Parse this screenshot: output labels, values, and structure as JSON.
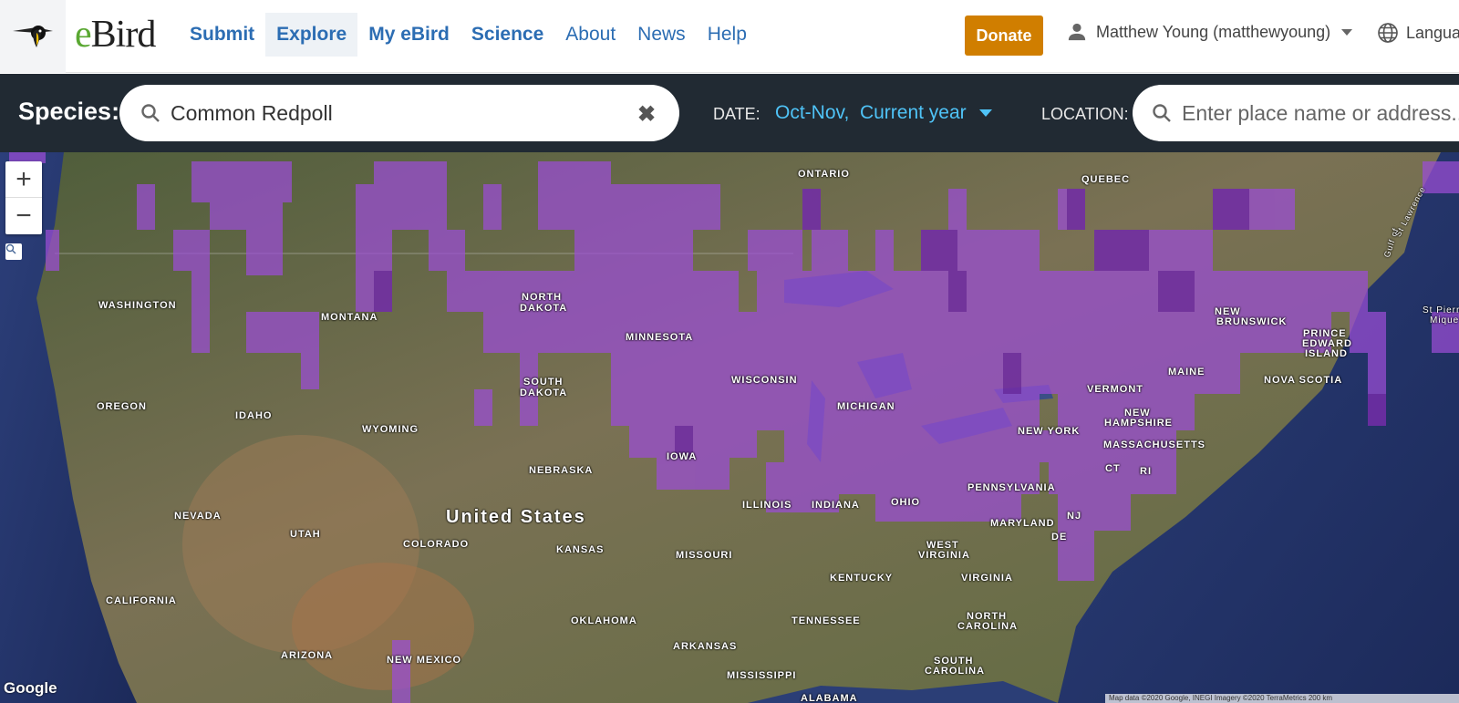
{
  "nav": {
    "logo_text_e": "e",
    "logo_text_rest": "Bird",
    "links": [
      {
        "label": "Submit",
        "bold": true
      },
      {
        "label": "Explore",
        "bold": true,
        "active": true
      },
      {
        "label": "My eBird",
        "bold": true
      },
      {
        "label": "Science",
        "bold": true
      },
      {
        "label": "About",
        "bold": false
      },
      {
        "label": "News",
        "bold": false
      },
      {
        "label": "Help",
        "bold": false
      }
    ],
    "donate_label": "Donate",
    "user_label": "Matthew Young (matthewyoung)",
    "language_label": "Langua"
  },
  "filters": {
    "species_label": "Species:",
    "species_value": "Common Redpoll",
    "date_label": "DATE:",
    "date_value": "Oct-Nov,  Current year",
    "location_label": "LOCATION:",
    "location_placeholder": "Enter place name or address..."
  },
  "map": {
    "zoom_in": "+",
    "zoom_out": "−",
    "google_label": "Google",
    "attribution": "Map data ©2020 Google, INEGI Imagery ©2020 TerraMetrics  200 km",
    "labels": {
      "ontario": "ONTARIO",
      "quebec": "QUEBEC",
      "washington": "WASHINGTON",
      "montana": "MONTANA",
      "north_dakota_1": "NORTH",
      "north_dakota_2": "DAKOTA",
      "minnesota": "MINNESOTA",
      "oregon": "OREGON",
      "idaho": "IDAHO",
      "wyoming": "WYOMING",
      "south_dakota_1": "SOUTH",
      "south_dakota_2": "DAKOTA",
      "wisconsin": "WISCONSIN",
      "michigan": "MICHIGAN",
      "nebraska": "NEBRASKA",
      "iowa": "IOWA",
      "nevada": "NEVADA",
      "utah": "UTAH",
      "colorado": "COLORADO",
      "kansas": "KANSAS",
      "missouri": "MISSOURI",
      "illinois": "ILLINOIS",
      "indiana": "INDIANA",
      "ohio": "OHIO",
      "pennsylvania": "PENNSYLVANIA",
      "new_york": "NEW YORK",
      "vermont": "VERMONT",
      "new_hampshire_1": "NEW",
      "new_hampshire_2": "HAMPSHIRE",
      "massachusetts": "MASSACHUSETTS",
      "maine": "MAINE",
      "new_brunswick_1": "NEW",
      "new_brunswick_2": "BRUNSWICK",
      "pei_1": "PRINCE",
      "pei_2": "EDWARD",
      "pei_3": "ISLAND",
      "nova_scotia": "NOVA SCOTIA",
      "ct": "CT",
      "ri": "RI",
      "nj": "NJ",
      "de": "DE",
      "maryland": "MARYLAND",
      "west_virginia_1": "WEST",
      "west_virginia_2": "VIRGINIA",
      "virginia": "VIRGINIA",
      "kentucky": "KENTUCKY",
      "tennessee": "TENNESSEE",
      "north_carolina_1": "NORTH",
      "north_carolina_2": "CAROLINA",
      "south_carolina_1": "SOUTH",
      "south_carolina_2": "CAROLINA",
      "california": "CALIFORNIA",
      "arizona": "ARIZONA",
      "new_mexico": "NEW MEXICO",
      "oklahoma": "OKLAHOMA",
      "arkansas": "ARKANSAS",
      "mississippi": "MISSISSIPPI",
      "alabama": "ALABAMA",
      "united_states": "United States",
      "gulf_1": "Gulf of",
      "gulf_2": "St Lawrence",
      "st_pierre_1": "St Pierre",
      "st_pierre_2": "Mique"
    }
  },
  "colors": {
    "brand_blue": "#2c6db3",
    "donate_orange": "#d07e00",
    "filter_bar": "#212a33",
    "date_accent": "#4fc3f7",
    "heat_purple": "#9b4dd6"
  }
}
